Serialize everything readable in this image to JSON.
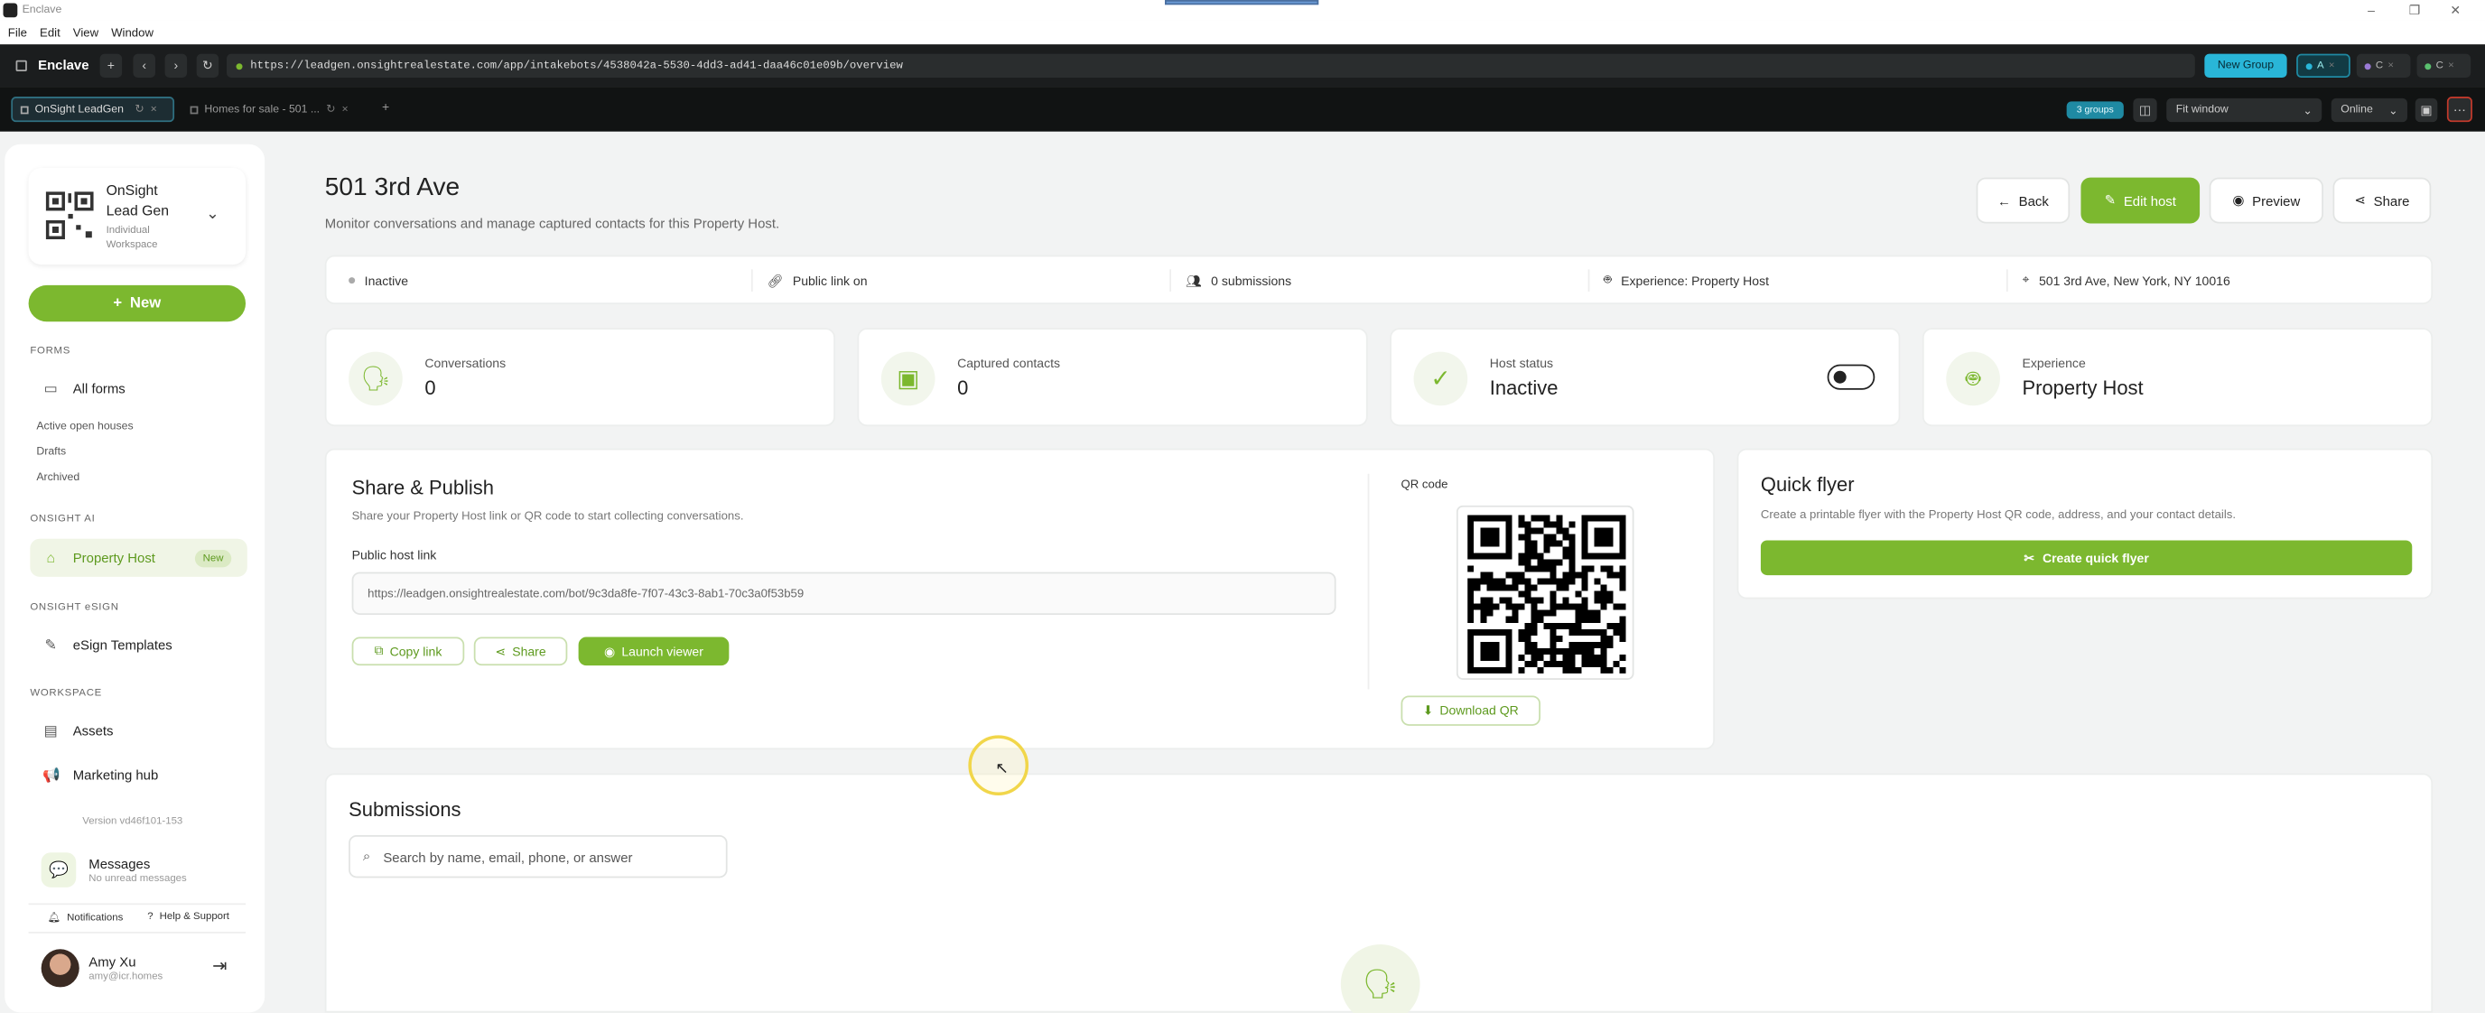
{
  "window": {
    "app_title": "Enclave",
    "menu": [
      "File",
      "Edit",
      "View",
      "Window"
    ],
    "controls": [
      "–",
      "❐",
      "✕"
    ]
  },
  "address_bar": {
    "brand": "Enclave",
    "url": "https://leadgen.onsightrealestate.com/app/intakebots/4538042a-5530-4dd3-ad41-daa46c01e09b/overview",
    "new_group": "New Group",
    "profiles": [
      "A",
      "C",
      "C"
    ]
  },
  "tabs": [
    {
      "label": "OnSight LeadGen",
      "active": true
    },
    {
      "label": "Homes for sale - 501 ...",
      "active": false
    }
  ],
  "tab_tools": {
    "groups_badge": "3 groups",
    "zoom": "Fit window",
    "status": "Online"
  },
  "sidebar": {
    "workspace_name_1": "OnSight",
    "workspace_name_2": "Lead Gen",
    "workspace_type_1": "Individual",
    "workspace_type_2": "Workspace",
    "new_button": "New",
    "forms_title": "FORMS",
    "all_forms": "All forms",
    "forms_sub": [
      "Active open houses",
      "Drafts",
      "Archived"
    ],
    "ai_title": "ONSIGHT AI",
    "property_host": "Property Host",
    "new_badge": "New",
    "esign_title": "ONSIGHT eSIGN",
    "esign_templates": "eSign Templates",
    "workspace_title": "WORKSPACE",
    "assets": "Assets",
    "marketing_hub": "Marketing hub",
    "version": "Version vd46f101-153",
    "messages_title": "Messages",
    "messages_sub": "No unread messages",
    "notifications": "Notifications",
    "help": "Help & Support",
    "user_name": "Amy Xu",
    "user_email": "amy@icr.homes"
  },
  "page": {
    "title": "501 3rd Ave",
    "subtitle": "Monitor conversations and manage captured contacts for this Property Host.",
    "back": "Back",
    "edit_host": "Edit host",
    "preview": "Preview",
    "share": "Share",
    "info": {
      "status": "Inactive",
      "public_link": "Public link on",
      "submissions": "0 submissions",
      "experience": "Experience: Property Host",
      "address": "501 3rd Ave, New York, NY 10016"
    },
    "stats": [
      {
        "label": "Conversations",
        "value": "0"
      },
      {
        "label": "Captured contacts",
        "value": "0"
      },
      {
        "label": "Host status",
        "value": "Inactive"
      },
      {
        "label": "Experience",
        "value": "Property Host"
      }
    ],
    "share_publish": {
      "title": "Share & Publish",
      "desc": "Share your Property Host link or QR code to start collecting conversations.",
      "link_label": "Public host link",
      "link": "https://leadgen.onsightrealestate.com/bot/9c3da8fe-7f07-43c3-8ab1-70c3a0f53b59",
      "copy_link": "Copy link",
      "share": "Share",
      "launch_viewer": "Launch viewer",
      "qr_label": "QR code",
      "download_qr": "Download QR"
    },
    "quick_flyer": {
      "title": "Quick flyer",
      "desc": "Create a printable flyer with the Property Host QR code, address, and your contact details.",
      "button": "Create quick flyer"
    },
    "submissions": {
      "title": "Submissions",
      "search_placeholder": "Search by name, email, phone, or answer"
    }
  },
  "colors": {
    "accent": "#7cb82f",
    "address_bar": "#1b1d1e",
    "tab_bar": "#111313",
    "new_group": "#29b6d8"
  }
}
